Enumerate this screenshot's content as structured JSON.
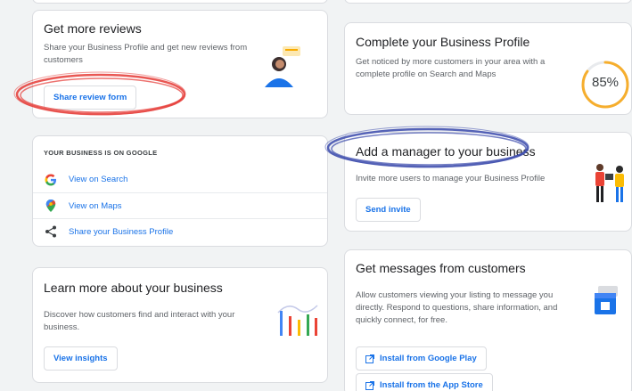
{
  "reviews_card": {
    "title": "Get more reviews",
    "description": "Share your Business Profile and get new reviews from customers",
    "button_label": "Share review form"
  },
  "on_google_card": {
    "heading": "YOUR BUSINESS IS ON GOOGLE",
    "links": [
      {
        "label": "View on Search",
        "icon": "google-g-icon"
      },
      {
        "label": "View on Maps",
        "icon": "maps-pin-icon"
      },
      {
        "label": "Share your Business Profile",
        "icon": "share-icon"
      }
    ]
  },
  "learn_card": {
    "title": "Learn more about your business",
    "description": "Discover how customers find and interact with your business.",
    "button_label": "View insights"
  },
  "profile_card": {
    "title": "Complete your Business Profile",
    "description": "Get noticed by more customers in your area with a complete profile on Search and Maps",
    "progress_label": "85%",
    "progress": 0.85
  },
  "manager_card": {
    "title": "Add a manager to your business",
    "description": "Invite more users to manage your Business Profile",
    "button_label": "Send invite"
  },
  "messages_card": {
    "title": "Get messages from customers",
    "description": "Allow customers viewing your listing to message you directly. Respond to questions, share information, and quickly connect, for free.",
    "play_button_label": "Install from Google Play",
    "appstore_button_label": "Install from the App Store"
  },
  "annotations": {
    "red_circle_color": "#e53935",
    "blue_circle_color": "#3949ab"
  },
  "colors": {
    "link": "#1a73e8",
    "google_blue": "#4285f4",
    "google_red": "#ea4335",
    "google_yellow": "#fbbc04",
    "google_green": "#34a853"
  }
}
